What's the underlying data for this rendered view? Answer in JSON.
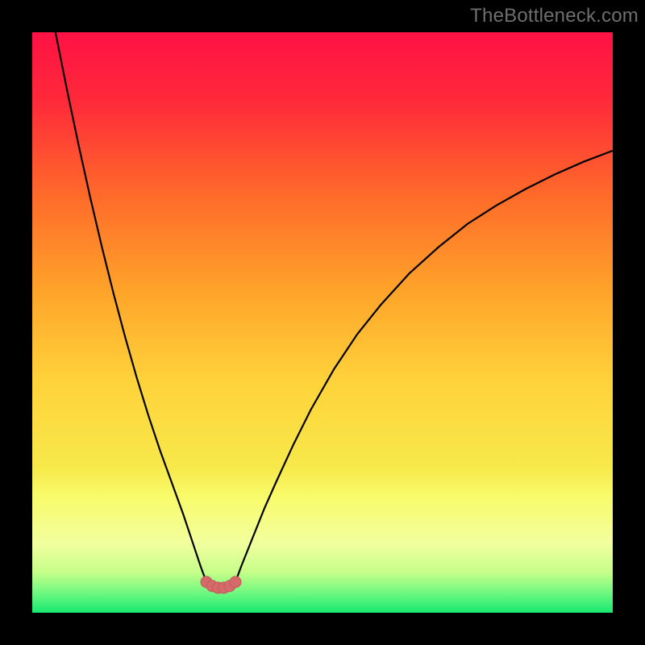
{
  "watermark": "TheBottleneck.com",
  "colors": {
    "black": "#000000",
    "gradient_stops": [
      {
        "offset": 0.0,
        "color": "#ff1144"
      },
      {
        "offset": 0.12,
        "color": "#ff2a3a"
      },
      {
        "offset": 0.28,
        "color": "#ff6a2a"
      },
      {
        "offset": 0.45,
        "color": "#ffa52a"
      },
      {
        "offset": 0.6,
        "color": "#ffd23a"
      },
      {
        "offset": 0.75,
        "color": "#f7e94a"
      },
      {
        "offset": 0.8,
        "color": "#f8fb6a"
      },
      {
        "offset": 0.88,
        "color": "#f2ff9e"
      },
      {
        "offset": 0.93,
        "color": "#c6ff8a"
      },
      {
        "offset": 0.97,
        "color": "#64f77f"
      },
      {
        "offset": 1.0,
        "color": "#17e86f"
      }
    ],
    "curve": "#000000",
    "marker_fill": "#d46a6a",
    "marker_stroke": "#c55a5a"
  },
  "chart_data": {
    "type": "line",
    "title": "",
    "xlabel": "",
    "ylabel": "",
    "xlim": [
      0,
      100
    ],
    "ylim": [
      0,
      100
    ],
    "series": [
      {
        "name": "left-curve",
        "x": [
          4,
          6,
          8,
          10,
          12,
          14,
          16,
          18,
          20,
          22,
          24,
          26,
          27,
          28,
          29,
          30
        ],
        "y": [
          100,
          90,
          80.5,
          71.5,
          63,
          55,
          47.5,
          40.5,
          34,
          28,
          22.5,
          17,
          14,
          11,
          8,
          5.3
        ]
      },
      {
        "name": "right-curve",
        "x": [
          35,
          36,
          37,
          38,
          40,
          42,
          45,
          48,
          52,
          56,
          60,
          65,
          70,
          75,
          80,
          85,
          90,
          95,
          100
        ],
        "y": [
          5.3,
          8,
          10.5,
          13,
          18,
          22.5,
          29,
          35,
          42,
          48,
          53,
          58.5,
          63,
          67,
          70.2,
          73,
          75.5,
          77.7,
          79.6
        ]
      },
      {
        "name": "valley-floor",
        "x": [
          30,
          31,
          32,
          33,
          34,
          35
        ],
        "y": [
          5.3,
          4.6,
          4.3,
          4.3,
          4.6,
          5.3
        ]
      }
    ],
    "markers": {
      "name": "valley-markers",
      "x": [
        30,
        31,
        32,
        33,
        34,
        35
      ],
      "y": [
        5.3,
        4.6,
        4.3,
        4.3,
        4.6,
        5.3
      ]
    }
  }
}
